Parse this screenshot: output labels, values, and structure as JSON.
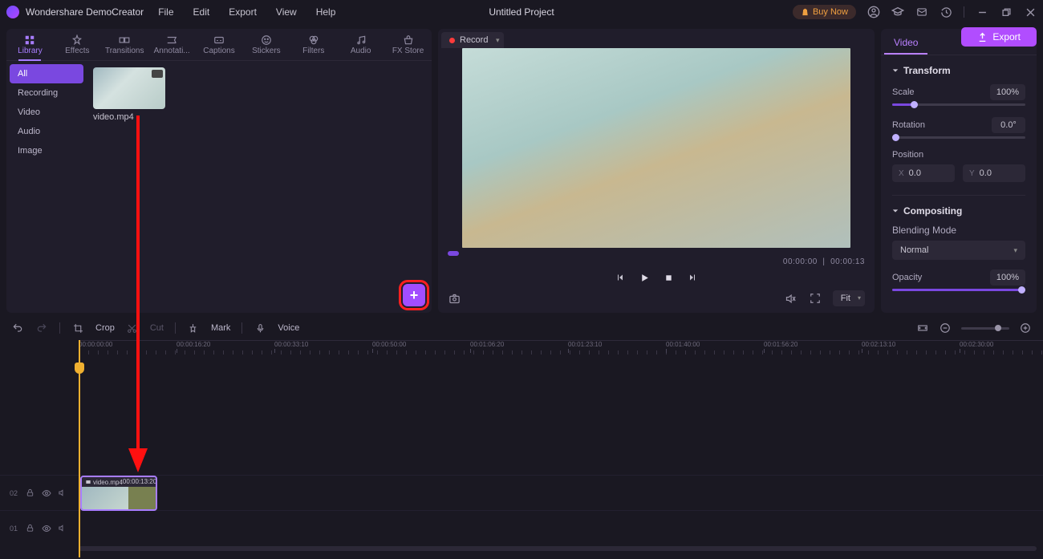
{
  "app": {
    "name": "Wondershare DemoCreator",
    "project_title": "Untitled Project"
  },
  "menus": {
    "file": "File",
    "edit": "Edit",
    "export": "Export",
    "view": "View",
    "help": "Help"
  },
  "titlebar_right": {
    "buy_now": "Buy Now"
  },
  "export_button": "Export",
  "record_button": "Record",
  "library": {
    "tabs": {
      "library": "Library",
      "effects": "Effects",
      "transitions": "Transitions",
      "annotations": "Annotati...",
      "captions": "Captions",
      "stickers": "Stickers",
      "filters": "Filters",
      "audio": "Audio",
      "fxstore": "FX Store"
    },
    "sidebar": {
      "all": "All",
      "recording": "Recording",
      "video": "Video",
      "audio": "Audio",
      "image": "Image"
    },
    "clip": {
      "name": "video.mp4"
    }
  },
  "preview": {
    "timecode_current": "00:00:00",
    "timecode_total": "00:00:13",
    "fit": "Fit"
  },
  "properties": {
    "tab": "Video",
    "transform": {
      "title": "Transform",
      "scale_label": "Scale",
      "scale_value": "100%",
      "rotation_label": "Rotation",
      "rotation_value": "0.0°",
      "position_label": "Position",
      "x_value": "0.0",
      "y_value": "0.0"
    },
    "compositing": {
      "title": "Compositing",
      "blend_label": "Blending Mode",
      "blend_value": "Normal",
      "opacity_label": "Opacity",
      "opacity_value": "100%"
    }
  },
  "toolbar": {
    "crop": "Crop",
    "cut": "Cut",
    "mark": "Mark",
    "voice": "Voice"
  },
  "ruler_ticks": [
    "00:00:00:00",
    "00:00:16:20",
    "00:00:33:10",
    "00:00:50:00",
    "00:01:06:20",
    "00:01:23:10",
    "00:01:40:00",
    "00:01:56:20",
    "00:02:13:10",
    "00:02:30:00"
  ],
  "timeline": {
    "track2": "02",
    "track1": "01",
    "clip": {
      "name": "video.mp4",
      "duration": "00:00:13:20"
    }
  }
}
